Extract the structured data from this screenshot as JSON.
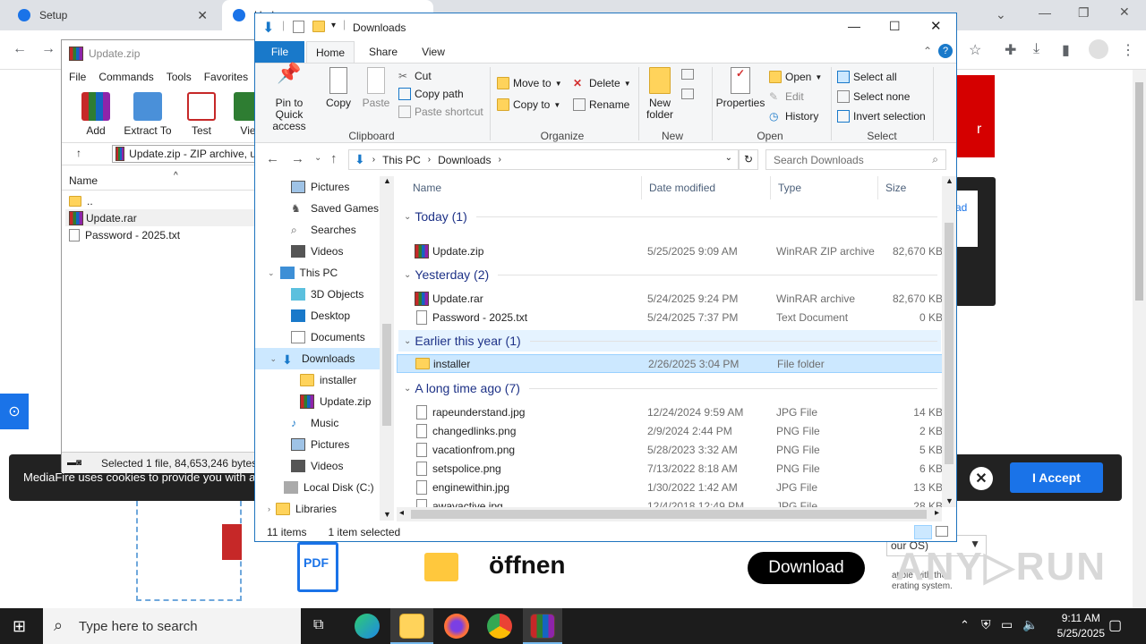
{
  "chrome": {
    "tab1": "Setup",
    "tab2": "Upd"
  },
  "webpage": {
    "cookie_text": "MediaFire uses cookies to provide you with a",
    "accept": "I Accept",
    "cookie_close": "✕",
    "download": "Download",
    "offnen": "öffnen",
    "compat_text1": "our OS)",
    "compat_text2": "atible with the",
    "compat_text3": "erating system.",
    "ad_text": "ad",
    "ad_text2": "r",
    "pdf_label": "PDF"
  },
  "winrar": {
    "title": "Update.zip",
    "menu": [
      "File",
      "Commands",
      "Tools",
      "Favorites"
    ],
    "tools": [
      "Add",
      "Extract To",
      "Test",
      "Vie"
    ],
    "path": "Update.zip - ZIP archive, u",
    "col_name": "Name",
    "rows": [
      "..",
      "Update.rar",
      "Password - 2025.txt"
    ],
    "status": "Selected 1 file, 84,653,246 bytes"
  },
  "explorer": {
    "title": "Downloads",
    "tabs": {
      "file": "File",
      "home": "Home",
      "share": "Share",
      "view": "View"
    },
    "ribbon": {
      "pin": "Pin to Quick access",
      "copy": "Copy",
      "paste": "Paste",
      "cut": "Cut",
      "copy_path": "Copy path",
      "paste_shortcut": "Paste shortcut",
      "clipboard": "Clipboard",
      "move_to": "Move to",
      "copy_to": "Copy to",
      "delete": "Delete",
      "rename": "Rename",
      "organize": "Organize",
      "new_folder": "New folder",
      "new": "New",
      "properties": "Properties",
      "open": "Open",
      "edit": "Edit",
      "history": "History",
      "open_group": "Open",
      "select_all": "Select all",
      "select_none": "Select none",
      "invert_selection": "Invert selection",
      "select_group": "Select"
    },
    "address": {
      "this_pc": "This PC",
      "downloads": "Downloads"
    },
    "search_placeholder": "Search Downloads",
    "nav": [
      "Pictures",
      "Saved Games",
      "Searches",
      "Videos",
      "This PC",
      "3D Objects",
      "Desktop",
      "Documents",
      "Downloads",
      "installer",
      "Update.zip",
      "Music",
      "Pictures",
      "Videos",
      "Local Disk (C:)",
      "Libraries"
    ],
    "columns": {
      "name": "Name",
      "date": "Date modified",
      "type": "Type",
      "size": "Size"
    },
    "groups": {
      "today": "Today (1)",
      "yesterday": "Yesterday (2)",
      "earlier": "Earlier this year (1)",
      "longago": "A long time ago (7)"
    },
    "files": [
      {
        "name": "Update.zip",
        "date": "5/25/2025 9:09 AM",
        "type": "WinRAR ZIP archive",
        "size": "82,670 KB"
      },
      {
        "name": "Update.rar",
        "date": "5/24/2025 9:24 PM",
        "type": "WinRAR archive",
        "size": "82,670 KB"
      },
      {
        "name": "Password - 2025.txt",
        "date": "5/24/2025 7:37 PM",
        "type": "Text Document",
        "size": "0 KB"
      },
      {
        "name": "installer",
        "date": "2/26/2025 3:04 PM",
        "type": "File folder",
        "size": ""
      },
      {
        "name": "rapeunderstand.jpg",
        "date": "12/24/2024 9:59 AM",
        "type": "JPG File",
        "size": "14 KB"
      },
      {
        "name": "changedlinks.png",
        "date": "2/9/2024 2:44 PM",
        "type": "PNG File",
        "size": "2 KB"
      },
      {
        "name": "vacationfrom.png",
        "date": "5/28/2023 3:32 AM",
        "type": "PNG File",
        "size": "5 KB"
      },
      {
        "name": "setspolice.png",
        "date": "7/13/2022 8:18 AM",
        "type": "PNG File",
        "size": "6 KB"
      },
      {
        "name": "enginewithin.jpg",
        "date": "1/30/2022 1:42 AM",
        "type": "JPG File",
        "size": "13 KB"
      },
      {
        "name": "awayactive.jpg",
        "date": "12/4/2018 12:49 PM",
        "type": "JPG File",
        "size": "28 KB"
      }
    ],
    "status": {
      "items": "11 items",
      "selected": "1 item selected"
    }
  },
  "taskbar": {
    "search_placeholder": "Type here to search",
    "time": "9:11 AM",
    "date": "5/25/2025"
  },
  "colors": {
    "accent": "#1979ca",
    "selection": "#cce8ff",
    "taskbar": "#1c1c1c"
  }
}
